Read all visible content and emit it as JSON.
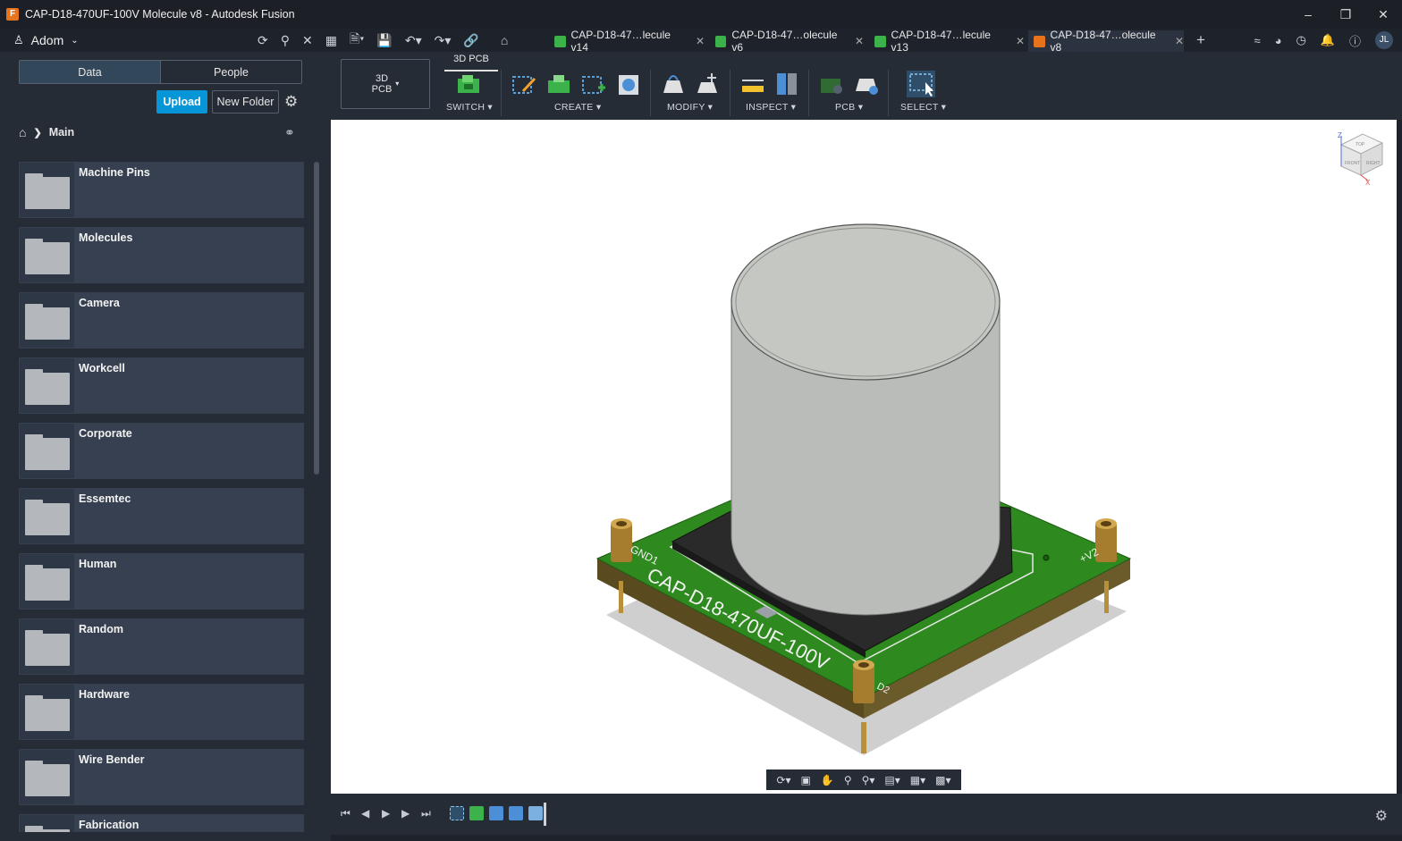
{
  "window": {
    "title": "CAP-D18-470UF-100V Molecule v8 - Autodesk Fusion",
    "app_icon": "F",
    "minimize": "–",
    "maximize": "❐",
    "close": "✕"
  },
  "tabbar": {
    "team_name": "Adom",
    "doc_tabs": [
      {
        "label": "CAP-D18-47…lecule v14",
        "close": "✕",
        "color": "#3cb34a"
      },
      {
        "label": "CAP-D18-47…olecule v6",
        "close": "✕",
        "color": "#3cb34a"
      },
      {
        "label": "CAP-D18-47…lecule v13",
        "close": "✕",
        "color": "#3cb34a"
      },
      {
        "label": "CAP-D18-47…olecule v8",
        "close": "✕",
        "color": "#e8731d"
      }
    ],
    "avatar": "JL"
  },
  "data_panel": {
    "tabs": [
      "Data",
      "People"
    ],
    "upload_label": "Upload",
    "new_folder_label": "New Folder",
    "breadcrumb": "Main",
    "folders": [
      "Machine Pins",
      "Molecules",
      "Camera",
      "Workcell",
      "Corporate",
      "Essemtec",
      "Human",
      "Random",
      "Hardware",
      "Wire Bender",
      "Fabrication"
    ]
  },
  "toolbar": {
    "workspace_label_1": "3D",
    "workspace_label_2": "PCB",
    "active_tab": "3D PCB",
    "groups": [
      "SWITCH ▾",
      "CREATE ▾",
      "MODIFY ▾",
      "INSPECT ▾",
      "PCB ▾",
      "SELECT ▾"
    ]
  },
  "model": {
    "board_text": "CAP-D18-470UF-100V",
    "label_gnd1": "GND1",
    "label_v2": "+V2",
    "label_2": "D2",
    "board_color": "#2e8a1e",
    "can_color": "#b9bcb8"
  },
  "viewcube": {
    "top": "TOP",
    "front": "FRONT",
    "right": "RIGHT",
    "z": "Z",
    "x": "X"
  }
}
